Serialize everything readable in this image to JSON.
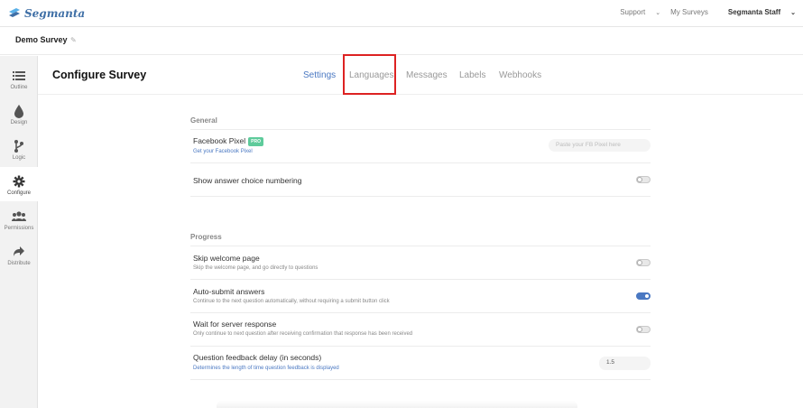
{
  "app": {
    "logo_text": "Segmanta"
  },
  "topnav": {
    "support": "Support",
    "my_surveys": "My Surveys",
    "staff": "Segmanta Staff"
  },
  "survey": {
    "name": "Demo Survey"
  },
  "sidebar": {
    "items": [
      {
        "label": "Outline",
        "icon": "list-icon"
      },
      {
        "label": "Design",
        "icon": "drop-icon"
      },
      {
        "label": "Logic",
        "icon": "branch-icon"
      },
      {
        "label": "Configure",
        "icon": "gear-icon",
        "active": true
      },
      {
        "label": "Permissions",
        "icon": "users-icon"
      },
      {
        "label": "Distribute",
        "icon": "share-icon"
      }
    ]
  },
  "header": {
    "title": "Configure Survey",
    "tabs": [
      "Settings",
      "Languages",
      "Messages",
      "Labels",
      "Webhooks"
    ],
    "active_tab": "Settings"
  },
  "general": {
    "title": "General",
    "facebook": {
      "title": "Facebook Pixel",
      "badge": "PRO",
      "link": "Get your Facebook Pixel",
      "placeholder": "Paste your FB Pixel here"
    },
    "numbering": {
      "title": "Show answer choice numbering",
      "on": false
    }
  },
  "progress": {
    "title": "Progress",
    "skip": {
      "title": "Skip welcome page",
      "sub": "Skip the welcome page, and go directly to questions",
      "on": false
    },
    "autosubmit": {
      "title": "Auto-submit answers",
      "sub": "Continue to the next question automatically, without requiring a submit button click",
      "on": true
    },
    "wait": {
      "title": "Wait for server response",
      "sub": "Only continue to next question after receiving confirmation that response has been received",
      "on": false
    },
    "delay": {
      "title": "Question feedback delay (in seconds)",
      "sub": "Determines the length of time question feedback is displayed",
      "value": "1.5"
    }
  },
  "colors": {
    "accent": "#4a78c2",
    "pro_badge": "#5ecb9b",
    "highlight": "#dd2222"
  }
}
